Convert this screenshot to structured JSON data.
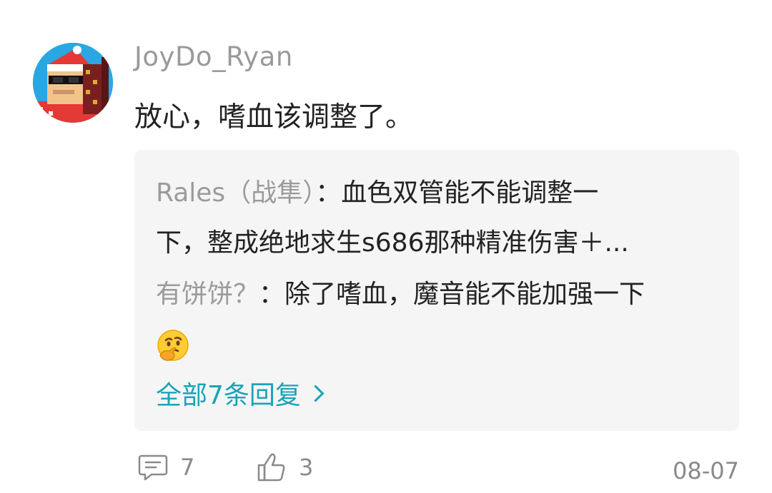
{
  "comment": {
    "username": "JoyDo_Ryan",
    "text": "放心，嗜血该调整了。"
  },
  "replies": [
    {
      "author": "Rales（战隼）",
      "separator": "：",
      "text_line1": "血色双管能不能调整一",
      "text_line2": "下，整成绝地求生s686那种精准伤害＋..."
    },
    {
      "author": "有饼饼？",
      "separator": "：",
      "text": "除了嗜血，魔音能不能加强一下"
    }
  ],
  "all_replies_label": "全部7条回复",
  "footer": {
    "comment_count": "7",
    "like_count": "3",
    "date": "08-07"
  },
  "colors": {
    "link": "#1aa3b8",
    "muted": "#9b9b9b",
    "reply_bg": "#f5f5f5"
  },
  "icons": {
    "comment": "comment-bubble-icon",
    "like": "thumbs-up-icon",
    "emoji": "thinking-face-emoji"
  }
}
